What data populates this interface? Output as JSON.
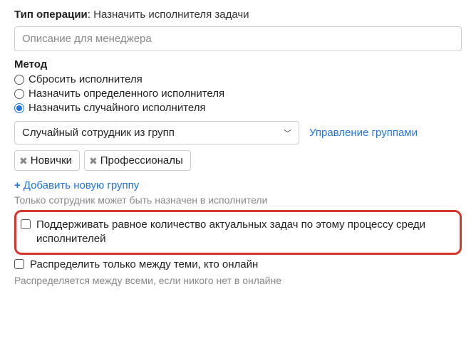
{
  "operation": {
    "label": "Тип операции",
    "value": "Назначить исполнителя задачи"
  },
  "description": {
    "placeholder": "Описание для менеджера"
  },
  "method": {
    "label": "Метод",
    "options": [
      {
        "label": "Сбросить исполнителя",
        "checked": false
      },
      {
        "label": "Назначить определенного исполнителя",
        "checked": false
      },
      {
        "label": "Назначить случайного исполнителя",
        "checked": true
      }
    ]
  },
  "select": {
    "value": "Случайный сотрудник из групп",
    "manage_link": "Управление группами"
  },
  "tags": [
    {
      "label": "Новички"
    },
    {
      "label": "Профессионалы"
    }
  ],
  "add_group": {
    "plus": "+",
    "label": "Добавить новую группу"
  },
  "note_top": "Только сотрудник может быть назначен в исполнители",
  "checks": {
    "balance": "Поддерживать равное количество актуальных задач по этому процессу среди исполнителей",
    "online": "Распределить только между теми, кто онлайн"
  },
  "note_bottom": "Распределяется между всеми, если никого нет в онлайне"
}
